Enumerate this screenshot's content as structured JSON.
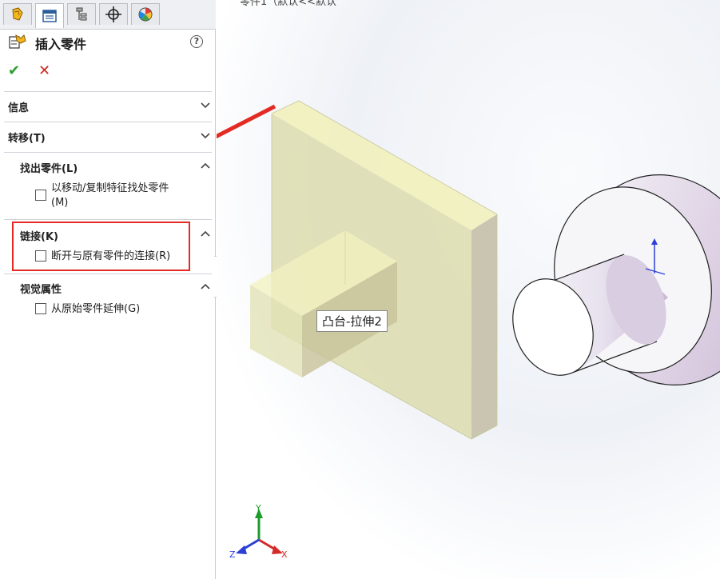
{
  "panel": {
    "tabs": [
      {
        "icon": "feature-manager-icon"
      },
      {
        "icon": "property-manager-icon"
      },
      {
        "icon": "configuration-manager-icon"
      },
      {
        "icon": "dimxpert-icon"
      },
      {
        "icon": "display-manager-icon"
      }
    ],
    "title": "插入零件",
    "help": "?",
    "ok": "✔",
    "cancel": "✕",
    "sections": {
      "info": "信息",
      "transfer": "转移(T)",
      "locate": "找出零件(L)",
      "locate_option": "以移动/复制特征找处零件",
      "locate_option_line2": "(M)",
      "link": "链接(K)",
      "link_option": "断开与原有零件的连接(R)",
      "visual": "视觉属性",
      "visual_option": "从原始零件延伸(G)"
    }
  },
  "viewport": {
    "top_text": "零件1（默认<<默认",
    "tooltip": "凸台-拉伸2",
    "triad": {
      "x": "X",
      "y": "Y",
      "z": "Z"
    }
  },
  "colors": {
    "highlight": "#e32b24",
    "ok": "#2c9c2c",
    "cancel": "#d0281c"
  }
}
